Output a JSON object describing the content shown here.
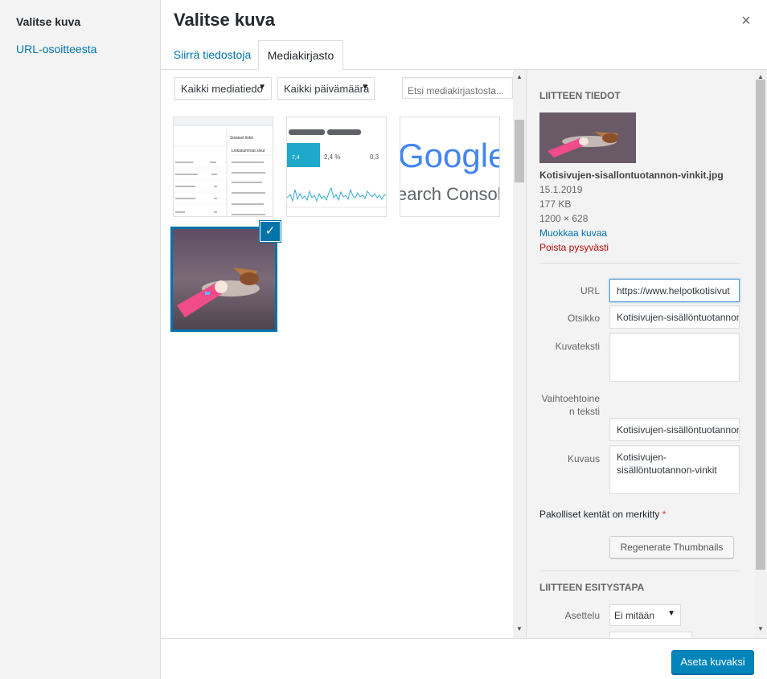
{
  "menu": {
    "active": "Valitse kuva",
    "link": "URL-osoitteesta"
  },
  "modal": {
    "title": "Valitse kuva",
    "close": "×"
  },
  "tabs": {
    "upload": "Siirrä tiedostoja",
    "library": "Mediakirjasto"
  },
  "toolbar": {
    "type_filter": "Kaikki mediatiedo",
    "date_filter": "Kaikki päivämäärä",
    "search_placeholder": "Etsi mediakirjastosta...",
    "arrow": "▼"
  },
  "grid": {
    "thumb1": {
      "title": "Sisäiset linkit",
      "heading": "Linkatuimmat sivut"
    },
    "thumb2": {
      "stat1": "7,4",
      "stat2": "2,4 %",
      "stat3": "0,3"
    },
    "thumb3": {
      "line1": "Google",
      "line2": "earch Console"
    },
    "check": "✓"
  },
  "details": {
    "heading": "Liitteen tiedot",
    "filename": "Kotisivujen-sisallontuotannon-vinkit.jpg",
    "date": "15.1.2019",
    "size": "177 KB",
    "dimensions": "1200 × 628",
    "edit": "Muokkaa kuvaa",
    "delete": "Poista pysyvästi"
  },
  "fields": {
    "url_label": "URL",
    "url_value": "https://www.helpotkotisivut",
    "title_label": "Otsikko",
    "title_value": "Kotisivujen-sisällöntuotannon",
    "caption_label": "Kuvateksti",
    "caption_value": "",
    "alt_label_1": "Vaihtoehtoine",
    "alt_label_2": "n teksti",
    "alt_value": "Kotisivujen-sisällöntuotannon",
    "desc_label": "Kuvaus",
    "desc_value_1": "Kotisivujen-",
    "desc_value_2": "sisällöntuotannon-vinkit"
  },
  "required_note": "Pakolliset kentät on merkitty",
  "required_star": "*",
  "regen_button": "Regenerate Thumbnails",
  "display": {
    "heading": "Liitteen esitystapa",
    "align_label": "Asettelu",
    "align_value": "Ei mitään"
  },
  "footer": {
    "primary": "Aseta kuvaksi"
  },
  "colors": {
    "accent": "#0073aa",
    "primary_button": "#0085ba",
    "danger": "#bc0b0b"
  }
}
